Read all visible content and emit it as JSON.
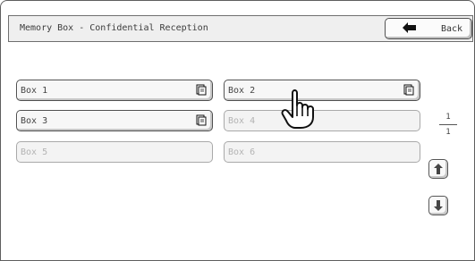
{
  "header": {
    "title": "Memory Box - Confidential Reception",
    "back_label": "Back"
  },
  "boxes": [
    {
      "label": "Box 1",
      "state": "enabled",
      "icon": "document-icon"
    },
    {
      "label": "Box 2",
      "state": "enabled",
      "icon": "document-icon"
    },
    {
      "label": "Box 3",
      "state": "enabled",
      "icon": "document-icon"
    },
    {
      "label": "Box 4",
      "state": "disabled"
    },
    {
      "label": "Box 5",
      "state": "disabled"
    },
    {
      "label": "Box 6",
      "state": "disabled"
    }
  ],
  "pagination": {
    "current": "1",
    "total": "1"
  },
  "icons": {
    "back": "left-arrow-icon",
    "scroll_up": "up-arrow-icon",
    "scroll_down": "down-arrow-icon",
    "cursor": "hand-pointer-icon"
  }
}
